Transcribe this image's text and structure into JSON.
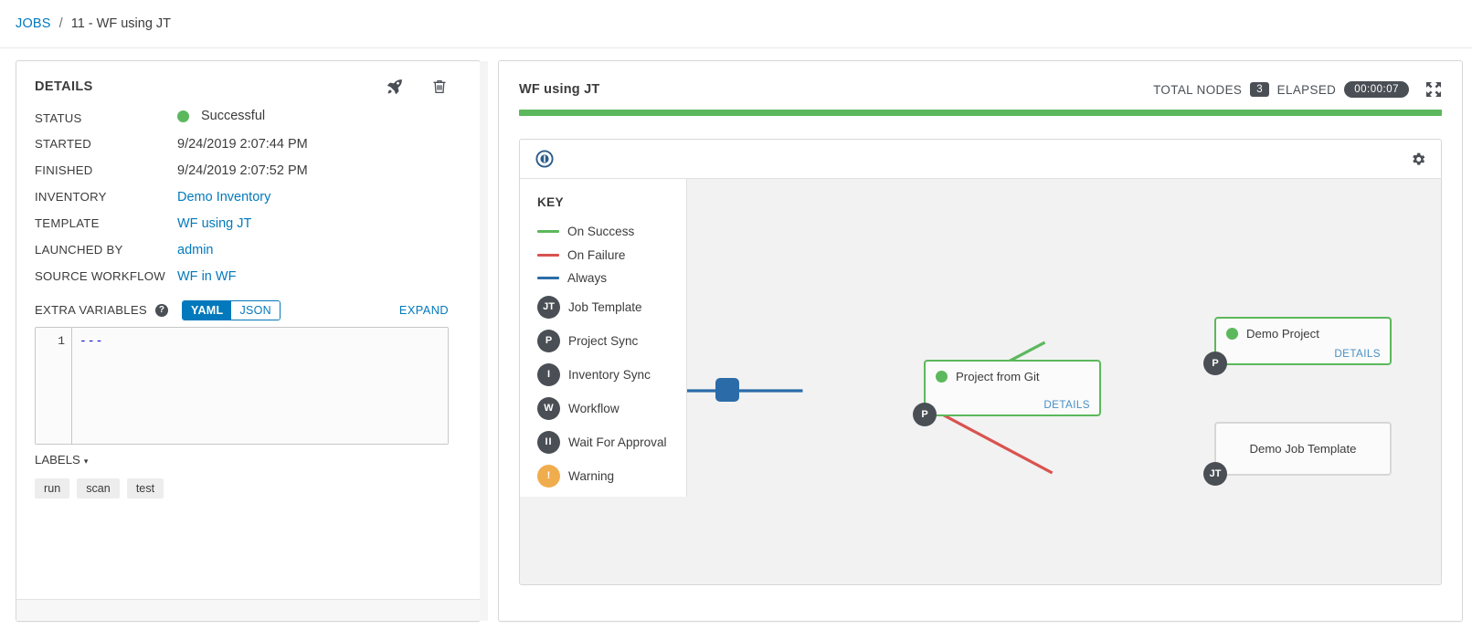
{
  "breadcrumb": {
    "root_label": "JOBS",
    "separator": "/",
    "current_label": "11 - WF using JT"
  },
  "details": {
    "title": "DETAILS",
    "actions": [
      {
        "name": "relaunch-icon",
        "label": "Relaunch"
      },
      {
        "name": "delete-icon",
        "label": "Delete"
      }
    ],
    "rows": [
      {
        "key": "STATUS",
        "value": "Successful",
        "type": "status",
        "dot_color": "#5cb85c"
      },
      {
        "key": "STARTED",
        "value": "9/24/2019 2:07:44 PM",
        "type": "text"
      },
      {
        "key": "FINISHED",
        "value": "9/24/2019 2:07:52 PM",
        "type": "text"
      },
      {
        "key": "INVENTORY",
        "value": "Demo Inventory",
        "type": "link"
      },
      {
        "key": "TEMPLATE",
        "value": "WF using JT",
        "type": "link"
      },
      {
        "key": "LAUNCHED BY",
        "value": "admin",
        "type": "link"
      },
      {
        "key": "SOURCE WORKFLOW",
        "value": "WF in WF",
        "type": "link"
      }
    ],
    "extra_variables": {
      "label": "EXTRA VARIABLES",
      "help_glyph": "?",
      "toggle_yaml": "YAML",
      "toggle_json": "JSON",
      "selected_format": "YAML",
      "expand_label": "EXPAND",
      "line_number": "1",
      "code": "---"
    },
    "labels_section": {
      "label": "LABELS",
      "caret": "▾",
      "chips": [
        "run",
        "scan",
        "test"
      ]
    }
  },
  "workflow": {
    "title": "WF using JT",
    "total_nodes_label": "TOTAL NODES",
    "total_nodes_value": "3",
    "elapsed_label": "ELAPSED",
    "elapsed_value": "00:00:07",
    "expand_icon_name": "expand-arrows-icon",
    "progress_color": "#5cb85c",
    "toolbar": {
      "left_icon": "compass-icon",
      "right_icon": "gear-icon"
    },
    "key": {
      "title": "KEY",
      "lines": [
        {
          "label": "On Success",
          "color": "#5cb85c"
        },
        {
          "label": "On Failure",
          "color": "#d9534f"
        },
        {
          "label": "Always",
          "color": "#2b6ca8"
        }
      ],
      "nodes": [
        {
          "glyph": "JT",
          "label": "Job Template",
          "color": "#4a4f55"
        },
        {
          "glyph": "P",
          "label": "Project Sync",
          "color": "#4a4f55"
        },
        {
          "glyph": "I",
          "label": "Inventory Sync",
          "color": "#4a4f55"
        },
        {
          "glyph": "W",
          "label": "Workflow",
          "color": "#4a4f55"
        },
        {
          "glyph": "II",
          "label": "Wait For Approval",
          "color": "#4a4f55"
        },
        {
          "glyph": "!",
          "label": "Warning",
          "color": "#f0ad4e"
        }
      ]
    },
    "graph": {
      "start_node": {
        "name": "start-node",
        "color": "#2b6ca8"
      },
      "nodes": [
        {
          "id": "project-from-git",
          "title": "Project from Git",
          "details_label": "DETAILS",
          "badge": "P",
          "status": "success",
          "border_color": "#5cb85c",
          "title_align": "left"
        },
        {
          "id": "demo-project",
          "title": "Demo Project",
          "details_label": "DETAILS",
          "badge": "P",
          "status": "success",
          "border_color": "#5cb85c",
          "title_align": "left"
        },
        {
          "id": "demo-job-template",
          "title": "Demo Job Template",
          "details_label": "",
          "badge": "JT",
          "status": "pending",
          "border_color": "#d7d7d7",
          "title_align": "center"
        }
      ],
      "edges": [
        {
          "from": "start",
          "to": "project-from-git",
          "type": "Always",
          "color": "#2b6ca8"
        },
        {
          "from": "project-from-git",
          "to": "demo-project",
          "type": "On Success",
          "color": "#5cb85c"
        },
        {
          "from": "project-from-git",
          "to": "demo-job-template",
          "type": "On Failure",
          "color": "#d9534f"
        }
      ]
    }
  }
}
